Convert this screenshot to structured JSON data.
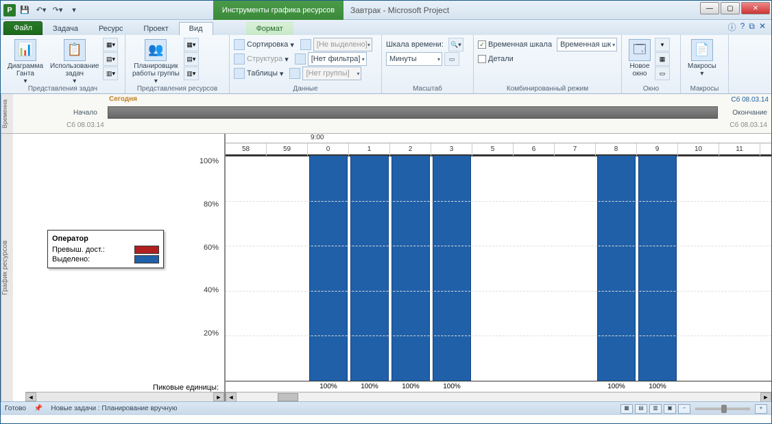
{
  "title": "Завтрак - Microsoft Project",
  "contextual_tab": "Инструменты графика ресурсов",
  "tabs": {
    "file": "Файл",
    "task": "Задача",
    "resource": "Ресурс",
    "project": "Проект",
    "view": "Вид",
    "format": "Формат"
  },
  "ribbon": {
    "gantt": "Диаграмма\nГанта",
    "task_usage": "Использование\nзадач",
    "task_views_label": "Представления задач",
    "team_planner": "Планировщик\nработы группы",
    "resource_views_label": "Представления ресурсов",
    "sort": "Сортировка",
    "structure": "Структура",
    "tables": "Таблицы",
    "no_highlight": "[Не выделено]",
    "no_filter": "[Нет фильтра]",
    "no_group": "[Нет группы]",
    "data_label": "Данные",
    "timescale": "Шкала времени:",
    "minutes": "Минуты",
    "scale_label": "Масштаб",
    "timeline_chk": "Временная шкала",
    "timeline_combo": "Временная шк",
    "details_chk": "Детали",
    "combined_label": "Комбинированный режим",
    "new_window": "Новое\nокно",
    "window_label": "Окно",
    "macros": "Макросы",
    "macros_label": "Макросы"
  },
  "timeline": {
    "vtab": "Временна",
    "today": "Сегодня",
    "start": "Начало",
    "end": "Окончание",
    "date1": "Сб 08.03.14",
    "date2": "Сб 08.03.14",
    "date3": "Сб 08.03.14"
  },
  "chart": {
    "vtab": "График ресурсов",
    "legend_title": "Оператор",
    "legend_over": "Превыш. дост.:",
    "legend_alloc": "Выделено:",
    "color_over": "#b02020",
    "color_alloc": "#2060a8",
    "peak_label": "Пиковые единицы:",
    "y_ticks": [
      "100%",
      "80%",
      "60%",
      "40%",
      "20%"
    ],
    "time_top": "9:00",
    "minutes": [
      "58",
      "59",
      "0",
      "1",
      "2",
      "3",
      "5",
      "6",
      "7",
      "8",
      "9",
      "10",
      "11"
    ]
  },
  "chart_data": {
    "type": "bar",
    "title": "Оператор",
    "ylabel": "%",
    "ylim": [
      0,
      100
    ],
    "x_unit": "minute",
    "categories": [
      "58",
      "59",
      "0",
      "1",
      "2",
      "3",
      "5",
      "6",
      "7",
      "8",
      "9",
      "10",
      "11"
    ],
    "series": [
      {
        "name": "Выделено",
        "color": "#2060a8",
        "values": [
          0,
          0,
          100,
          100,
          100,
          100,
          0,
          0,
          0,
          100,
          100,
          0,
          0
        ]
      },
      {
        "name": "Превыш. дост.",
        "color": "#b02020",
        "values": [
          0,
          0,
          0,
          0,
          0,
          0,
          0,
          0,
          0,
          0,
          0,
          0,
          0
        ]
      }
    ],
    "peak_units": [
      "",
      "",
      "100%",
      "100%",
      "100%",
      "100%",
      "",
      "",
      "",
      "100%",
      "100%",
      "",
      ""
    ]
  },
  "status": {
    "ready": "Готово",
    "new_tasks": "Новые задачи : Планирование вручную"
  }
}
